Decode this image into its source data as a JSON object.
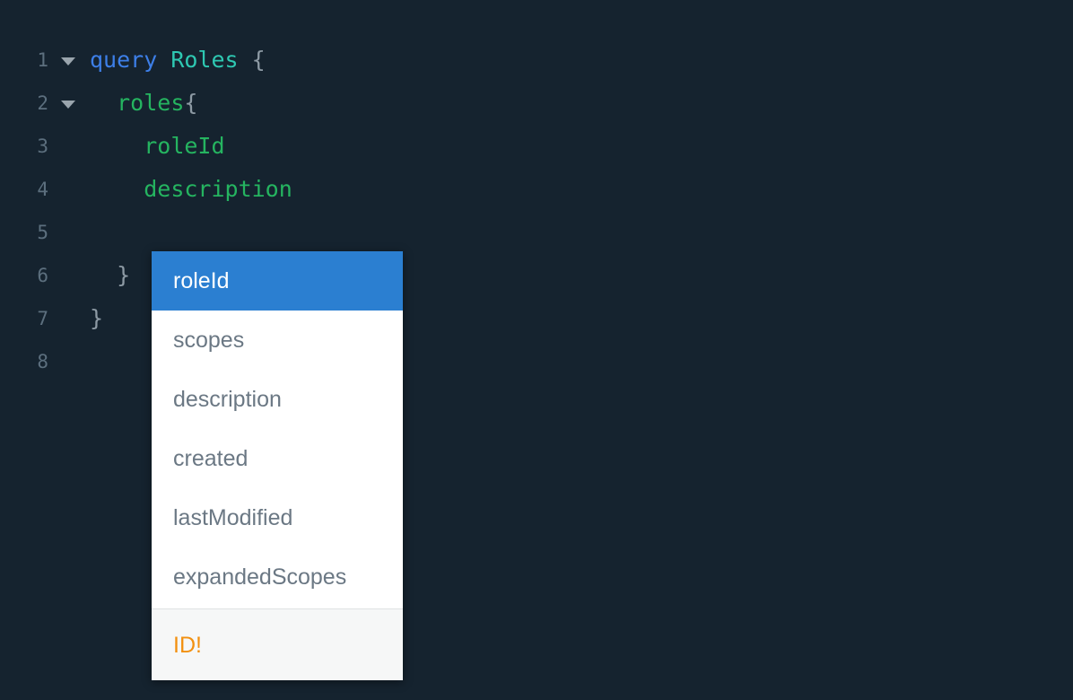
{
  "editor": {
    "theme_background": "#15232f",
    "gutter_color": "#5c6f7e",
    "lines": [
      {
        "number": "1",
        "foldable": true,
        "indent": "",
        "tokens": [
          {
            "text": "query",
            "kind": "kw"
          },
          {
            "text": " ",
            "kind": "plain"
          },
          {
            "text": "Roles",
            "kind": "opname"
          },
          {
            "text": " ",
            "kind": "plain"
          },
          {
            "text": "{",
            "kind": "punct"
          }
        ]
      },
      {
        "number": "2",
        "foldable": true,
        "indent": "  ",
        "tokens": [
          {
            "text": "roles",
            "kind": "field"
          },
          {
            "text": "{",
            "kind": "punct"
          }
        ]
      },
      {
        "number": "3",
        "foldable": false,
        "indent": "    ",
        "tokens": [
          {
            "text": "roleId",
            "kind": "field"
          }
        ]
      },
      {
        "number": "4",
        "foldable": false,
        "indent": "    ",
        "tokens": [
          {
            "text": "description",
            "kind": "field"
          }
        ]
      },
      {
        "number": "5",
        "foldable": false,
        "indent": "    ",
        "tokens": []
      },
      {
        "number": "6",
        "foldable": false,
        "indent": "  ",
        "tokens": [
          {
            "text": "}",
            "kind": "punct"
          }
        ]
      },
      {
        "number": "7",
        "foldable": false,
        "indent": "",
        "tokens": [
          {
            "text": "}",
            "kind": "punct"
          }
        ]
      },
      {
        "number": "8",
        "foldable": false,
        "indent": "",
        "tokens": []
      }
    ]
  },
  "autocomplete": {
    "selected_index": 0,
    "selected_background": "#2b7fd1",
    "item_color": "#6b7884",
    "items": [
      {
        "label": "roleId"
      },
      {
        "label": "scopes"
      },
      {
        "label": "description"
      },
      {
        "label": "created"
      },
      {
        "label": "lastModified"
      },
      {
        "label": "expandedScopes"
      }
    ],
    "footer": {
      "type_label": "ID!",
      "type_color": "#f29010"
    }
  }
}
